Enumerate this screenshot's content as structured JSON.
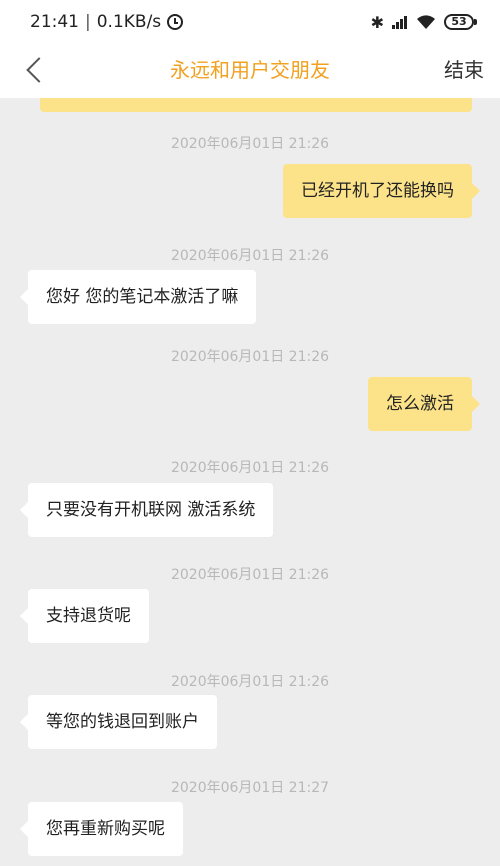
{
  "status_bar": {
    "time": "21:41",
    "separator": "|",
    "speed": "0.1KB/s",
    "battery": "53"
  },
  "nav": {
    "title": "永远和用户交朋友",
    "end_label": "结束"
  },
  "colors": {
    "accent": "#f2a020",
    "outgoing_bubble": "#fce38a",
    "incoming_bubble": "#ffffff",
    "background": "#ededed"
  },
  "messages": [
    {
      "time": "2020年06月01日 21:26",
      "side": "right",
      "text": "已经开机了还能换吗"
    },
    {
      "time": "2020年06月01日 21:26",
      "side": "left",
      "text": "您好 您的笔记本激活了嘛"
    },
    {
      "time": "2020年06月01日 21:26",
      "side": "right",
      "text": "怎么激活"
    },
    {
      "time": "2020年06月01日 21:26",
      "side": "left",
      "text": "只要没有开机联网 激活系统"
    },
    {
      "time": "2020年06月01日 21:26",
      "side": "left",
      "text": "支持退货呢"
    },
    {
      "time": "2020年06月01日 21:26",
      "side": "left",
      "text": "等您的钱退回到账户"
    },
    {
      "time": "2020年06月01日 21:27",
      "side": "left",
      "text": "您再重新购买呢"
    }
  ]
}
